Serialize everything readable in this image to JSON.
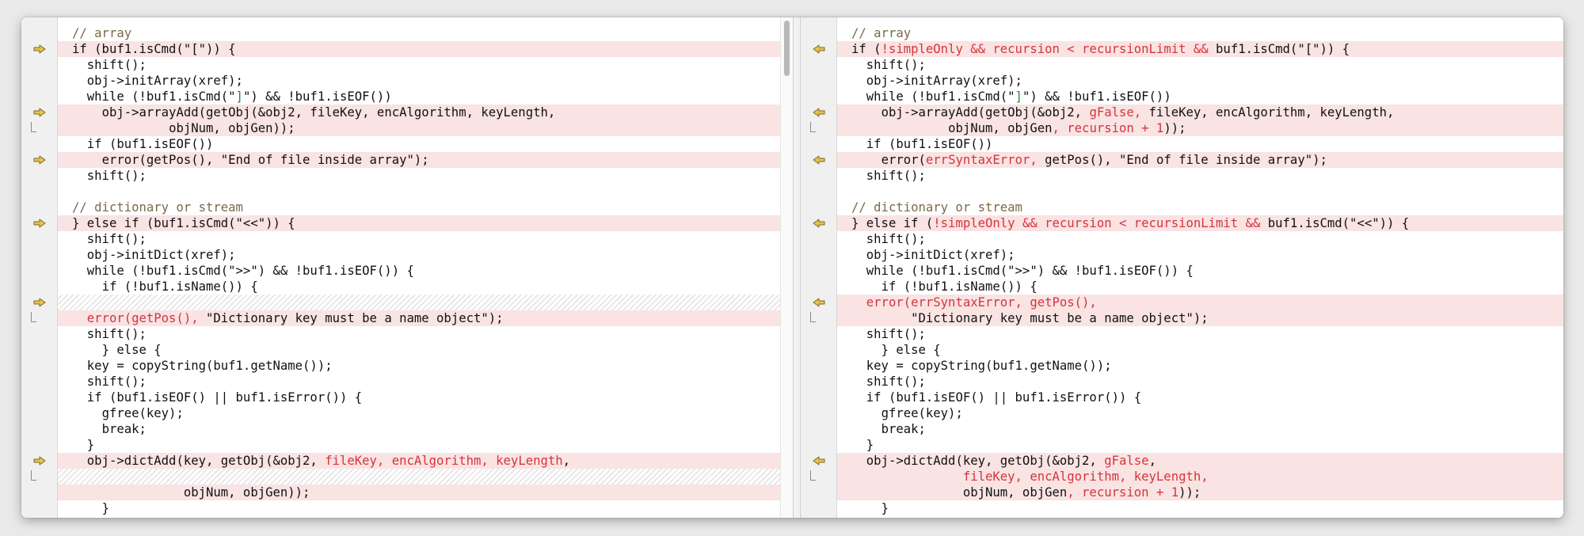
{
  "colors": {
    "changed_bg": "#f9e3e3",
    "changed_text": "#d6343a",
    "comment": "#7a6a48",
    "string_green": "#2a8a2a",
    "arrow_fill": "#e8c24b"
  },
  "icons": {
    "left_marker": "arrow-right-icon",
    "right_marker": "arrow-left-icon",
    "continuation": "bracket-continuation-icon"
  },
  "left": {
    "lines": [
      {
        "ind": 0,
        "segs": [
          {
            "t": "// array",
            "c": "comment"
          }
        ]
      },
      {
        "ind": 0,
        "hl": true,
        "m": true,
        "segs": [
          {
            "t": "if (buf1.isCmd(\"[\")) {"
          }
        ]
      },
      {
        "ind": 2,
        "segs": [
          {
            "t": "shift();"
          }
        ]
      },
      {
        "ind": 2,
        "segs": [
          {
            "t": "obj->initArray(xref);"
          }
        ]
      },
      {
        "ind": 2,
        "segs": [
          {
            "t": "while (!buf1.isCmd(\""
          },
          {
            "t": "]",
            "c": "green"
          },
          {
            "t": "\") && !buf1.isEOF())"
          }
        ]
      },
      {
        "ind": 4,
        "hl": true,
        "m": true,
        "segs": [
          {
            "t": "obj->arrayAdd(getObj(&obj2, fileKey, encAlgorithm, keyLength,"
          }
        ]
      },
      {
        "ind": 13,
        "hl": true,
        "cont": true,
        "segs": [
          {
            "t": "objNum, objGen));"
          }
        ]
      },
      {
        "ind": 2,
        "segs": [
          {
            "t": "if (buf1.isEOF())"
          }
        ]
      },
      {
        "ind": 4,
        "hl": true,
        "m": true,
        "segs": [
          {
            "t": "error(getPos(), \"End of file inside array\");"
          }
        ]
      },
      {
        "ind": 2,
        "segs": [
          {
            "t": "shift();"
          }
        ]
      },
      {
        "ind": 0,
        "segs": []
      },
      {
        "ind": 0,
        "segs": [
          {
            "t": "// dictionary or stream",
            "c": "comment"
          }
        ]
      },
      {
        "ind": 0,
        "hl": true,
        "m": true,
        "segs": [
          {
            "t": "} else if (buf1.isCmd(\"<<\")) {"
          }
        ]
      },
      {
        "ind": 2,
        "segs": [
          {
            "t": "shift();"
          }
        ]
      },
      {
        "ind": 2,
        "segs": [
          {
            "t": "obj->initDict(xref);"
          }
        ]
      },
      {
        "ind": 2,
        "segs": [
          {
            "t": "while (!buf1.isCmd(\">>\") && !buf1.isEOF()) {"
          }
        ]
      },
      {
        "ind": 4,
        "segs": [
          {
            "t": "if (!buf1.isName()) {"
          }
        ]
      },
      {
        "ind": 0,
        "filler": true,
        "m": true,
        "segs": []
      },
      {
        "ind": 2,
        "hl": true,
        "cont": true,
        "segs": [
          {
            "t": "error(getPos(), ",
            "c": "red"
          },
          {
            "t": "\"Dictionary key must be a name object\");"
          }
        ]
      },
      {
        "ind": 2,
        "segs": [
          {
            "t": "shift();"
          }
        ]
      },
      {
        "ind": 4,
        "segs": [
          {
            "t": "} else {"
          }
        ]
      },
      {
        "ind": 2,
        "segs": [
          {
            "t": "key = copyString(buf1.getName());"
          }
        ]
      },
      {
        "ind": 2,
        "segs": [
          {
            "t": "shift();"
          }
        ]
      },
      {
        "ind": 2,
        "segs": [
          {
            "t": "if (buf1.isEOF() || buf1.isError()) {"
          }
        ]
      },
      {
        "ind": 4,
        "segs": [
          {
            "t": "gfree(key);"
          }
        ]
      },
      {
        "ind": 4,
        "segs": [
          {
            "t": "break;"
          }
        ]
      },
      {
        "ind": 2,
        "segs": [
          {
            "t": "}"
          }
        ]
      },
      {
        "ind": 2,
        "hl": true,
        "m": true,
        "segs": [
          {
            "t": "obj->dictAdd(key, getObj(&obj2, "
          },
          {
            "t": "fileKey, encAlgorithm, keyLength",
            "c": "red"
          },
          {
            "t": ","
          }
        ]
      },
      {
        "ind": 0,
        "filler": true,
        "cont": true,
        "segs": []
      },
      {
        "ind": 15,
        "hl": true,
        "segs": [
          {
            "t": "objNum, objGen));"
          }
        ]
      },
      {
        "ind": 4,
        "segs": [
          {
            "t": "}"
          }
        ]
      }
    ]
  },
  "right": {
    "lines": [
      {
        "ind": 0,
        "segs": [
          {
            "t": "// array",
            "c": "comment"
          }
        ]
      },
      {
        "ind": 0,
        "hl": true,
        "m": true,
        "segs": [
          {
            "t": "if ("
          },
          {
            "t": "!simpleOnly && recursion < recursionLimit && ",
            "c": "red"
          },
          {
            "t": "buf1.isCmd(\"[\")) {"
          }
        ]
      },
      {
        "ind": 2,
        "segs": [
          {
            "t": "shift();"
          }
        ]
      },
      {
        "ind": 2,
        "segs": [
          {
            "t": "obj->initArray(xref);"
          }
        ]
      },
      {
        "ind": 2,
        "segs": [
          {
            "t": "while (!buf1.isCmd(\""
          },
          {
            "t": "]",
            "c": "green"
          },
          {
            "t": "\") && !buf1.isEOF())"
          }
        ]
      },
      {
        "ind": 4,
        "hl": true,
        "m": true,
        "segs": [
          {
            "t": "obj->arrayAdd(getObj(&obj2, "
          },
          {
            "t": "gFalse, ",
            "c": "red"
          },
          {
            "t": "fileKey, encAlgorithm, keyLength,"
          }
        ]
      },
      {
        "ind": 13,
        "hl": true,
        "cont": true,
        "segs": [
          {
            "t": "objNum, objGen"
          },
          {
            "t": ", recursion + 1",
            "c": "red"
          },
          {
            "t": "));"
          }
        ]
      },
      {
        "ind": 2,
        "segs": [
          {
            "t": "if (buf1.isEOF())"
          }
        ]
      },
      {
        "ind": 4,
        "hl": true,
        "m": true,
        "segs": [
          {
            "t": "error("
          },
          {
            "t": "errSyntaxError, ",
            "c": "red"
          },
          {
            "t": "getPos(), \"End of file inside array\");"
          }
        ]
      },
      {
        "ind": 2,
        "segs": [
          {
            "t": "shift();"
          }
        ]
      },
      {
        "ind": 0,
        "segs": []
      },
      {
        "ind": 0,
        "segs": [
          {
            "t": "// dictionary or stream",
            "c": "comment"
          }
        ]
      },
      {
        "ind": 0,
        "hl": true,
        "m": true,
        "segs": [
          {
            "t": "} else if ("
          },
          {
            "t": "!simpleOnly && recursion < recursionLimit && ",
            "c": "red"
          },
          {
            "t": "buf1.isCmd(\"<<\")) {"
          }
        ]
      },
      {
        "ind": 2,
        "segs": [
          {
            "t": "shift();"
          }
        ]
      },
      {
        "ind": 2,
        "segs": [
          {
            "t": "obj->initDict(xref);"
          }
        ]
      },
      {
        "ind": 2,
        "segs": [
          {
            "t": "while (!buf1.isCmd(\">>\") && !buf1.isEOF()) {"
          }
        ]
      },
      {
        "ind": 4,
        "segs": [
          {
            "t": "if (!buf1.isName()) {"
          }
        ]
      },
      {
        "ind": 2,
        "hl": true,
        "m": true,
        "segs": [
          {
            "t": "error(errSyntaxError, getPos(),",
            "c": "red"
          }
        ]
      },
      {
        "ind": 8,
        "hl": true,
        "cont": true,
        "segs": [
          {
            "t": "\"Dictionary key must be a name object\");"
          }
        ]
      },
      {
        "ind": 2,
        "segs": [
          {
            "t": "shift();"
          }
        ]
      },
      {
        "ind": 4,
        "segs": [
          {
            "t": "} else {"
          }
        ]
      },
      {
        "ind": 2,
        "segs": [
          {
            "t": "key = copyString(buf1.getName());"
          }
        ]
      },
      {
        "ind": 2,
        "segs": [
          {
            "t": "shift();"
          }
        ]
      },
      {
        "ind": 2,
        "segs": [
          {
            "t": "if (buf1.isEOF() || buf1.isError()) {"
          }
        ]
      },
      {
        "ind": 4,
        "segs": [
          {
            "t": "gfree(key);"
          }
        ]
      },
      {
        "ind": 4,
        "segs": [
          {
            "t": "break;"
          }
        ]
      },
      {
        "ind": 2,
        "segs": [
          {
            "t": "}"
          }
        ]
      },
      {
        "ind": 2,
        "hl": true,
        "m": true,
        "segs": [
          {
            "t": "obj->dictAdd(key, getObj(&obj2, "
          },
          {
            "t": "gFalse",
            "c": "red"
          },
          {
            "t": ","
          }
        ]
      },
      {
        "ind": 15,
        "hl": true,
        "cont": true,
        "segs": [
          {
            "t": "fileKey, encAlgorithm, keyLength,",
            "c": "red"
          }
        ]
      },
      {
        "ind": 15,
        "hl": true,
        "segs": [
          {
            "t": "objNum, objGen"
          },
          {
            "t": ", recursion + 1",
            "c": "red"
          },
          {
            "t": "));"
          }
        ]
      },
      {
        "ind": 4,
        "segs": [
          {
            "t": "}"
          }
        ]
      }
    ]
  }
}
